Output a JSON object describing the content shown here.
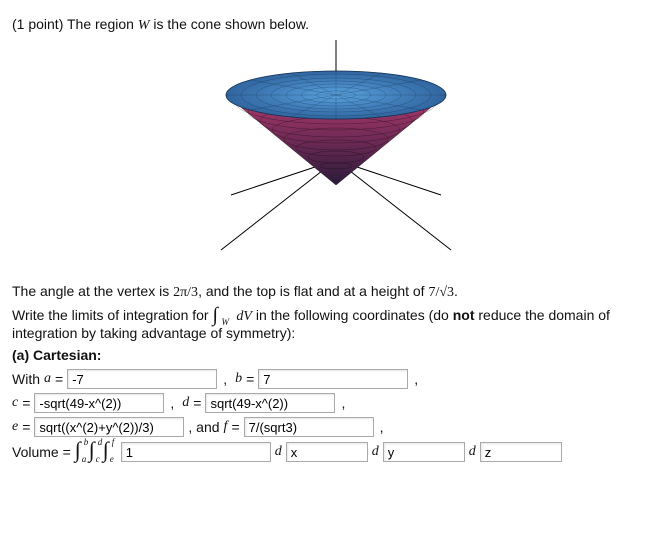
{
  "intro": {
    "points_prefix": "(1 point) The region ",
    "region_var": "W",
    "points_suffix": " is the cone shown below."
  },
  "desc": {
    "p1a": "The angle at the vertex is ",
    "angle": "2π/3",
    "p1b": ", and the top is flat and at a height of ",
    "height_tex": "7/√3",
    "p1c": "."
  },
  "instr": {
    "a": "Write the limits of integration for ",
    "int_sub": "W",
    "dV": "dV",
    "b": " in the following coordinates (do ",
    "not": "not",
    "c": " reduce the domain of integration by taking advantage of symmetry):"
  },
  "partA": {
    "label": "(a) Cartesian:",
    "witha": "With ",
    "a_var": "a",
    "eq": " = ",
    "b_var": "b",
    "c_var": "c",
    "d_var": "d",
    "e_var": "e",
    "f_var": "f",
    "andf": ", and ",
    "a_val": "-7",
    "b_val": "7",
    "c_val": "-sqrt(49-x^(2))",
    "d_val": "sqrt(49-x^(2))",
    "e_val": "sqrt((x^(2)+y^(2))/3)",
    "f_val": "7/(sqrt3)"
  },
  "volume": {
    "label": "Volume = ",
    "int1_lo": "a",
    "int1_hi": "b",
    "int2_lo": "c",
    "int2_hi": "d",
    "int3_lo": "e",
    "int3_hi": "f",
    "integrand": "1",
    "d1": "x",
    "d2": "y",
    "d3": "z",
    "d_sym": "d"
  }
}
